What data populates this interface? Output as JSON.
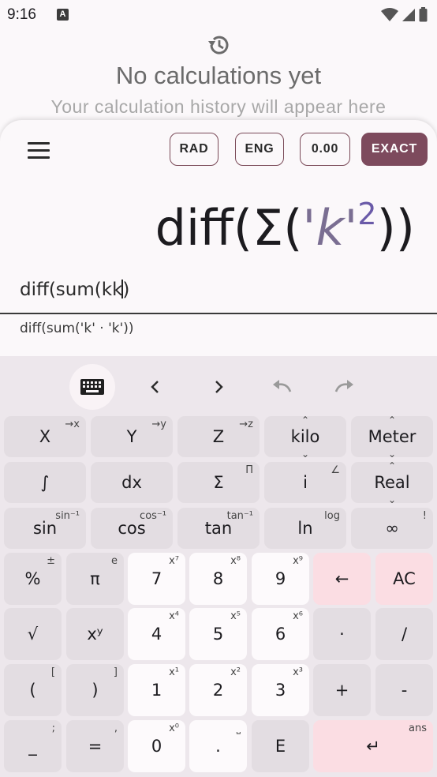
{
  "status": {
    "time": "9:16",
    "notification_badge": "A"
  },
  "history": {
    "title": "No calculations yet",
    "subtitle": "Your calculation history will appear here"
  },
  "modes": {
    "angle": "RAD",
    "notation": "ENG",
    "precision": "0.00",
    "exact": "EXACT"
  },
  "display": {
    "prefix": "diff(Σ(",
    "quote_open": "'",
    "var": "k",
    "quote_close": "'",
    "power": "2",
    "suffix": "))"
  },
  "input": {
    "before_caret": "diff(sum(kk",
    "after_caret": ")"
  },
  "preview": {
    "text": "diff(sum('k' · 'k'))"
  },
  "toolbar": {
    "keyboard_icon": "keyboard-icon",
    "left_icon": "chevron-left-icon",
    "right_icon": "chevron-right-icon",
    "undo_icon": "undo-icon",
    "redo_icon": "redo-icon"
  },
  "sci_rows": [
    [
      {
        "main": "X",
        "sup": "→x"
      },
      {
        "main": "Y",
        "sup": "→y"
      },
      {
        "main": "Z",
        "sup": "→z"
      },
      {
        "main": "kilo",
        "updown": true
      },
      {
        "main": "Meter",
        "updown": true
      }
    ],
    [
      {
        "main": "∫",
        "sup": ""
      },
      {
        "main": "dx",
        "sup": ""
      },
      {
        "main": "Σ",
        "sup": "Π"
      },
      {
        "main": "i",
        "sup": "∠"
      },
      {
        "main": "Real",
        "updown": true
      }
    ],
    [
      {
        "main": "sin",
        "sup": "sin⁻¹"
      },
      {
        "main": "cos",
        "sup": "cos⁻¹"
      },
      {
        "main": "tan",
        "sup": "tan⁻¹"
      },
      {
        "main": "ln",
        "sup": "log"
      },
      {
        "main": "∞",
        "sup": "!"
      }
    ]
  ],
  "num_rows": [
    [
      {
        "main": "%",
        "sup": "±"
      },
      {
        "main": "π",
        "sup": "e"
      },
      {
        "main": "7",
        "sup": "x⁷"
      },
      {
        "main": "8",
        "sup": "x⁸"
      },
      {
        "main": "9",
        "sup": "x⁹"
      },
      {
        "main": "←",
        "sup": ""
      },
      {
        "main": "AC",
        "sup": ""
      }
    ],
    [
      {
        "main": "√",
        "sup": ""
      },
      {
        "main": "xʸ",
        "sup": ""
      },
      {
        "main": "4",
        "sup": "x⁴"
      },
      {
        "main": "5",
        "sup": "x⁵"
      },
      {
        "main": "6",
        "sup": "x⁶"
      },
      {
        "main": "·",
        "sup": ""
      },
      {
        "main": "/",
        "sup": ""
      }
    ],
    [
      {
        "main": "(",
        "sup": "["
      },
      {
        "main": ")",
        "sup": "]"
      },
      {
        "main": "1",
        "sup": "x¹"
      },
      {
        "main": "2",
        "sup": "x²"
      },
      {
        "main": "3",
        "sup": "x³"
      },
      {
        "main": "+",
        "sup": ""
      },
      {
        "main": "-",
        "sup": ""
      }
    ],
    [
      {
        "main": "_",
        "sup": ";"
      },
      {
        "main": "=",
        "sup": ","
      },
      {
        "main": "0",
        "sup": "x⁰"
      },
      {
        "main": ".",
        "sup": "⎵"
      },
      {
        "main": "E",
        "sup": ""
      },
      {
        "main": "↵",
        "sup": "ans"
      }
    ]
  ]
}
